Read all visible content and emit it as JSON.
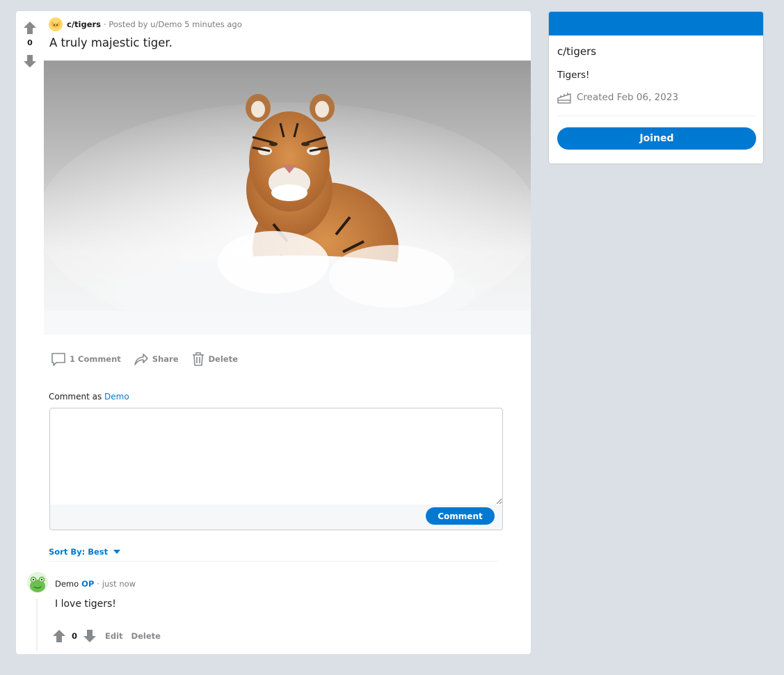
{
  "post": {
    "score": "0",
    "subreddit": "c/tigers",
    "posted_by": "· Posted by u/Demo 5 minutes ago",
    "title": "A truly majestic tiger.",
    "actions": {
      "comments": "1 Comment",
      "share": "Share",
      "delete": "Delete"
    }
  },
  "comment_form": {
    "prefix": "Comment as",
    "username": "Demo",
    "placeholder": "",
    "submit_label": "Comment"
  },
  "sort": {
    "label": "Sort By: Best"
  },
  "comments": [
    {
      "author": "Demo",
      "badge": "OP",
      "time": "· just now",
      "body": "I love tigers!",
      "score": "0",
      "edit_label": "Edit",
      "delete_label": "Delete"
    }
  ],
  "sidebar": {
    "community_name": "c/tigers",
    "description": "Tigers!",
    "created": "Created Feb 06, 2023",
    "join_label": "Joined"
  },
  "colors": {
    "accent": "#0079d3",
    "page_bg": "#dae0e6",
    "icon_grey": "#878a8c"
  },
  "icons": [
    "upvote-icon",
    "downvote-icon",
    "comment-icon",
    "share-icon",
    "trash-icon",
    "cake-icon",
    "caret-down-icon",
    "frog-avatar",
    "cat-face-icon"
  ]
}
